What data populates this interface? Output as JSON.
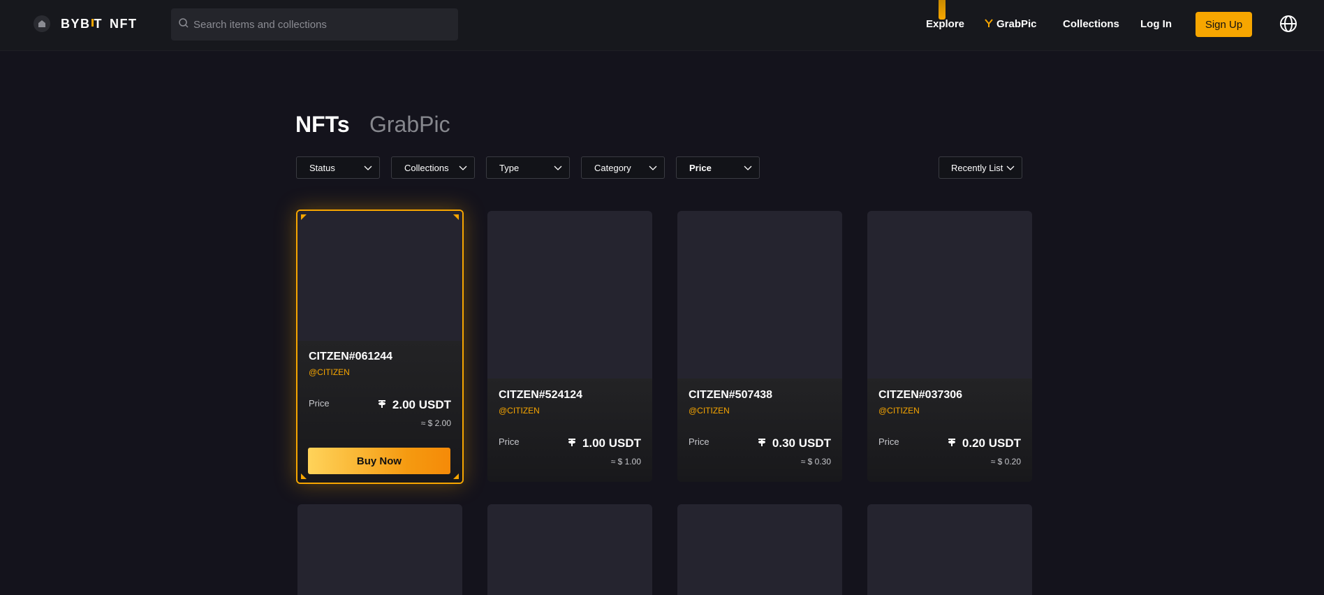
{
  "header": {
    "logo_text_1": "BYB",
    "logo_text_2": "T",
    "logo_text_3": "NFT",
    "search_placeholder": "Search items and collections",
    "nav": {
      "explore": "Explore",
      "grabpic": "GrabPic",
      "collections": "Collections",
      "login": "Log In",
      "signup": "Sign Up"
    },
    "accent_color": "#f7a600"
  },
  "tabs": {
    "nfts": "NFTs",
    "grabpic": "GrabPic"
  },
  "filters": {
    "status": "Status",
    "collections": "Collections",
    "type": "Type",
    "category": "Category",
    "price": "Price",
    "sort": "Recently List"
  },
  "cards": [
    {
      "name": "CITZEN#061244",
      "owner": "@CITIZEN",
      "price_label": "Price",
      "price": "2.00 USDT",
      "usd": "≈ $ 2.00",
      "buy_label": "Buy Now"
    },
    {
      "name": "CITZEN#524124",
      "owner": "@CITIZEN",
      "price_label": "Price",
      "price": "1.00 USDT",
      "usd": "≈ $ 1.00"
    },
    {
      "name": "CITZEN#507438",
      "owner": "@CITIZEN",
      "price_label": "Price",
      "price": "0.30 USDT",
      "usd": "≈ $ 0.30"
    },
    {
      "name": "CITZEN#037306",
      "owner": "@CITIZEN",
      "price_label": "Price",
      "price": "0.20 USDT",
      "usd": "≈ $ 0.20"
    }
  ]
}
